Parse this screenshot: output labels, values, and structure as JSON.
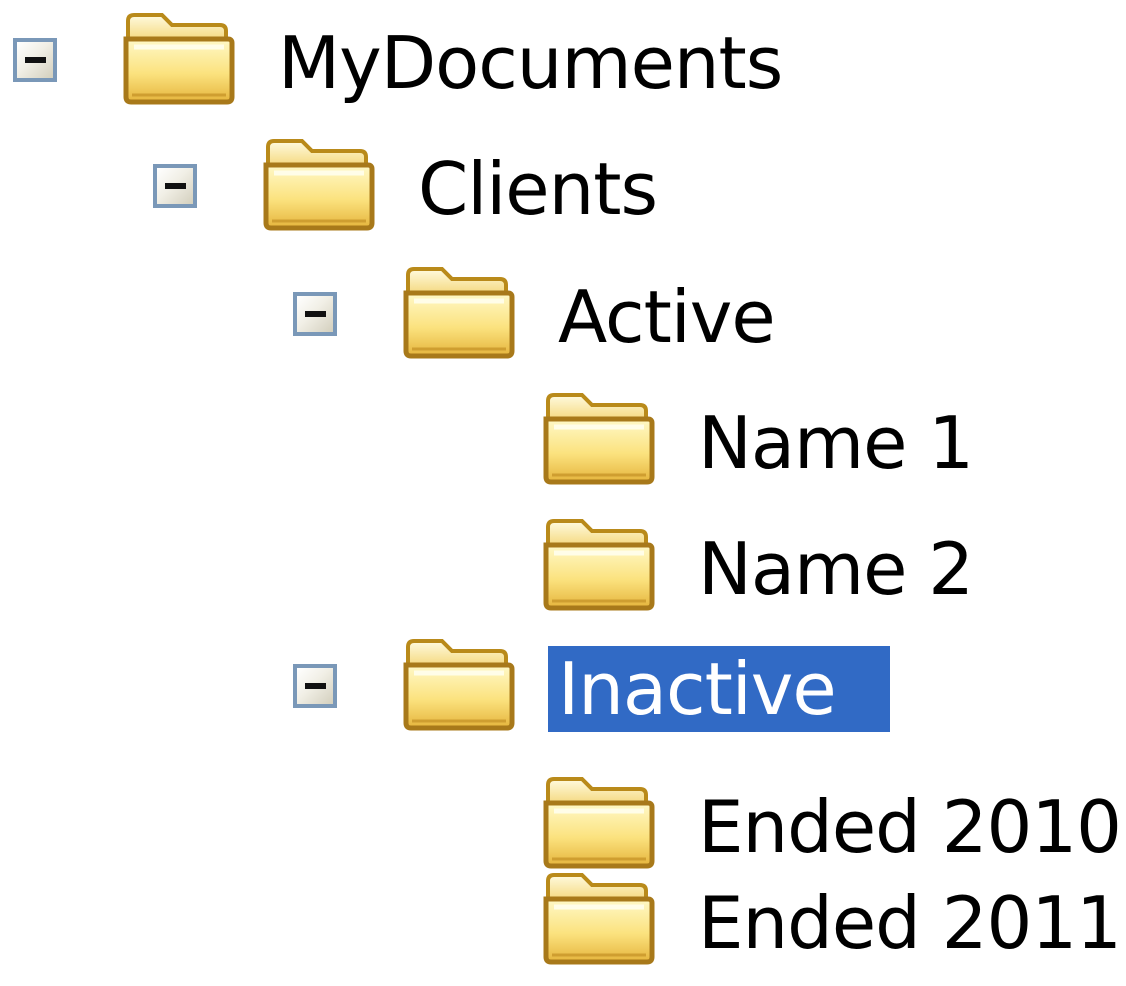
{
  "tree": {
    "selected_color": "#316ac5",
    "nodes": [
      {
        "label": "MyDocuments",
        "expanded": true,
        "has_children": true,
        "selected": false
      },
      {
        "label": "Clients",
        "expanded": true,
        "has_children": true,
        "selected": false
      },
      {
        "label": "Active",
        "expanded": true,
        "has_children": true,
        "selected": false
      },
      {
        "label": "Name 1",
        "expanded": false,
        "has_children": false,
        "selected": false
      },
      {
        "label": "Name 2",
        "expanded": false,
        "has_children": false,
        "selected": false
      },
      {
        "label": "Inactive",
        "expanded": true,
        "has_children": true,
        "selected": true
      },
      {
        "label": "Ended 2010",
        "expanded": false,
        "has_children": false,
        "selected": false
      },
      {
        "label": "Ended 2011",
        "expanded": false,
        "has_children": false,
        "selected": false
      }
    ]
  },
  "icons": {
    "expander": "minus-box-icon",
    "folder": "folder-icon"
  }
}
